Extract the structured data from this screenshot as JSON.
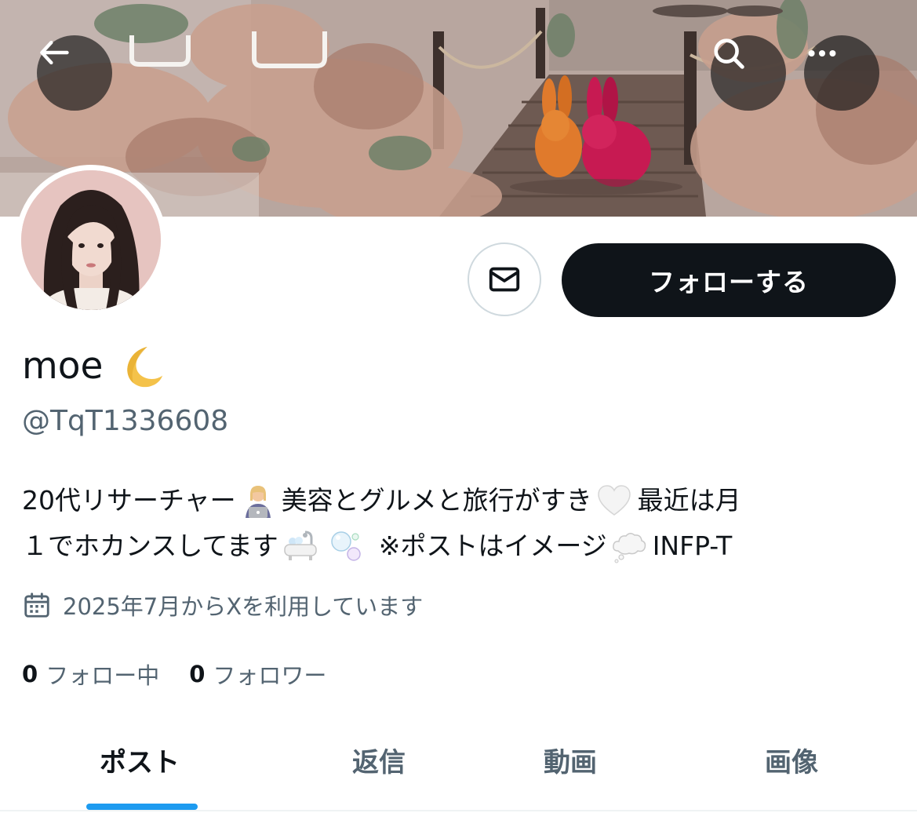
{
  "header": {
    "back_icon": "arrow-left-icon",
    "search_icon": "search-icon",
    "more_icon": "more-horizontal-icon"
  },
  "profile": {
    "display_name": "moe",
    "display_name_emoji": "crescent-moon-icon",
    "handle": "@TqT1336608",
    "bio": {
      "line1_part1": "20代リサーチャー",
      "line1_part2": "美容とグルメと旅行がすき",
      "line1_part3": "最近は月",
      "line2_part1": "１でホカンスしてます",
      "line2_part2": "※ポストはイメージ",
      "line2_part3": "INFP-T",
      "emoji_1": "woman-technologist-emoji",
      "emoji_2": "white-heart-emoji",
      "emoji_3": "bathtub-emoji",
      "emoji_4": "bubbles-emoji",
      "emoji_5": "thought-balloon-emoji"
    },
    "joined_text": "2025年7月からXを利用しています",
    "following_count": "0",
    "following_label": "フォロー中",
    "followers_count": "0",
    "followers_label": "フォロワー"
  },
  "actions": {
    "follow_label": "フォローする",
    "message_icon": "mail-icon"
  },
  "tabs": [
    {
      "label": "ポスト",
      "active": true
    },
    {
      "label": "返信",
      "active": false
    },
    {
      "label": "動画",
      "active": false
    },
    {
      "label": "画像",
      "active": false
    }
  ],
  "colors": {
    "accent": "#1d9bf0",
    "text_primary": "#0f1419",
    "text_secondary": "#536471",
    "follow_button": "#0f1419"
  }
}
